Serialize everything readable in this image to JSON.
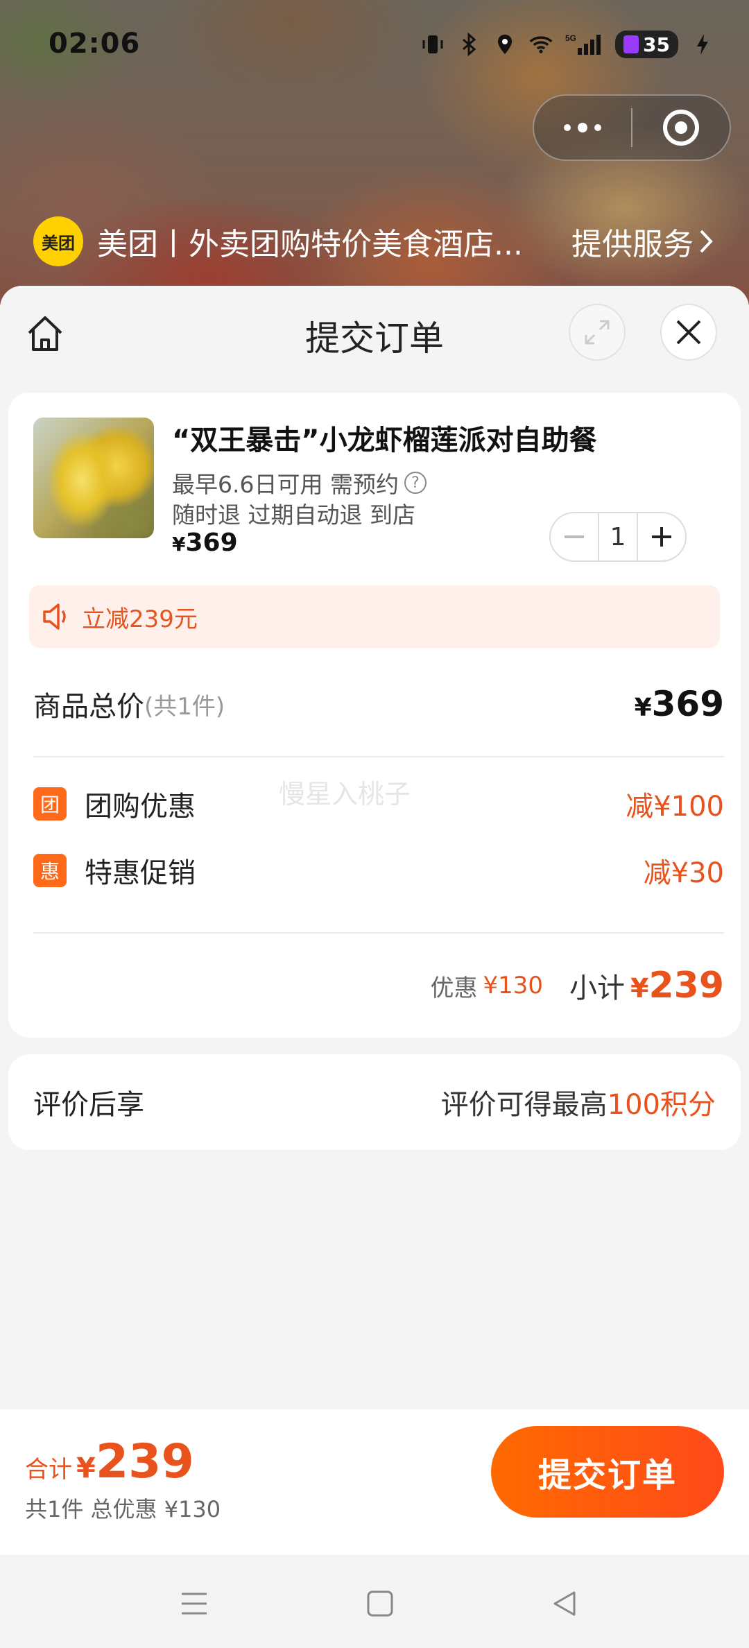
{
  "status_bar": {
    "time": "02:06",
    "network": "5G",
    "battery": "35"
  },
  "capsule": {
    "more_icon": "more-dots-icon",
    "close_icon": "target-icon"
  },
  "mini_program": {
    "logo_text": "美团",
    "name": "美团丨外卖团购特价美食酒店...",
    "service_label": "提供服务"
  },
  "sheet": {
    "title": "提交订单"
  },
  "product": {
    "title": "“双王暴击”小龙虾榴莲派对自助餐",
    "availability": "最早6.6日可用 需预约",
    "refund": "随时退 过期自动退 到店",
    "price_symbol": "¥",
    "price": "369",
    "quantity": "1"
  },
  "promo_banner": {
    "text": "立减239元"
  },
  "summary": {
    "total_label": "商品总价",
    "total_count": "(共1件)",
    "total_symbol": "¥",
    "total_value": "369",
    "watermark": "慢星入桃子",
    "discounts": [
      {
        "tag": "团",
        "label": "团购优惠",
        "value": "减¥100"
      },
      {
        "tag": "惠",
        "label": "特惠促销",
        "value": "减¥30"
      }
    ],
    "subtotal_discount_label": "优惠",
    "subtotal_discount_value": "¥130",
    "subtotal_label": "小计",
    "subtotal_symbol": "¥",
    "subtotal_value": "239"
  },
  "review": {
    "label": "评价后享",
    "reward_prefix": "评价可得最高",
    "reward_highlight": "100积分"
  },
  "bottom_bar": {
    "total_label": "合计",
    "total_symbol": "¥",
    "total_value": "239",
    "sub_text": "共1件 总优惠 ¥130",
    "submit_label": "提交订单"
  },
  "colors": {
    "accent": "#e8521c",
    "button": "#ff5a10",
    "promo_bg": "#fff0ec",
    "brand_yellow": "#ffd100"
  }
}
